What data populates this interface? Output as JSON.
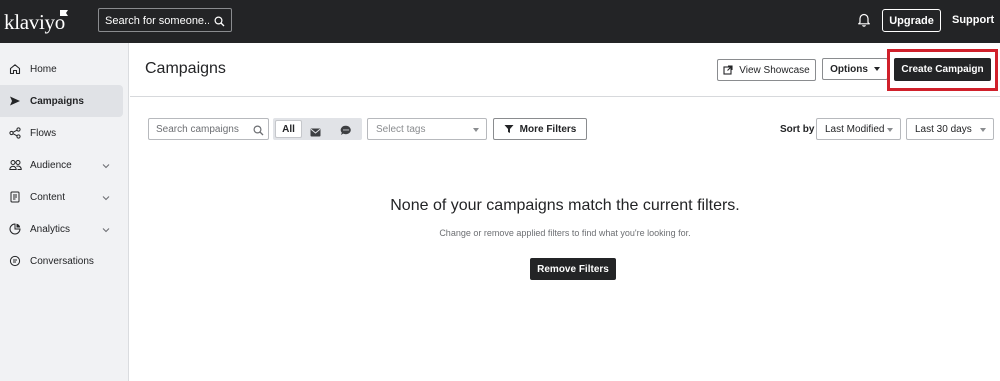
{
  "brand": {
    "logo_text": "klaviyo"
  },
  "topbar": {
    "search_placeholder": "Search for someone...",
    "upgrade_label": "Upgrade",
    "support_label": "Support"
  },
  "sidebar": {
    "items": [
      {
        "label": "Home",
        "icon": "home-icon"
      },
      {
        "label": "Campaigns",
        "icon": "campaigns-send-icon",
        "active": true
      },
      {
        "label": "Flows",
        "icon": "flows-icon"
      },
      {
        "label": "Audience",
        "icon": "audience-icon",
        "expandable": true
      },
      {
        "label": "Content",
        "icon": "content-icon",
        "expandable": true
      },
      {
        "label": "Analytics",
        "icon": "analytics-icon",
        "expandable": true
      },
      {
        "label": "Conversations",
        "icon": "conversations-icon"
      }
    ]
  },
  "header": {
    "title": "Campaigns",
    "view_showcase_label": "View Showcase",
    "options_label": "Options",
    "create_campaign_label": "Create Campaign"
  },
  "filters": {
    "search_placeholder": "Search campaigns",
    "channel_all_label": "All",
    "tags_placeholder": "Select tags",
    "more_filters_label": "More Filters",
    "sort_by_label": "Sort by",
    "sort_value": "Last Modified",
    "date_range_value": "Last 30 days"
  },
  "empty_state": {
    "title": "None of your campaigns match the current filters.",
    "subtitle": "Change or remove applied filters to find what you're looking for.",
    "remove_filters_label": "Remove Filters"
  },
  "colors": {
    "topbar_bg": "#232426",
    "sidebar_bg": "#f1f2f4",
    "highlight_border": "#d0202b"
  }
}
